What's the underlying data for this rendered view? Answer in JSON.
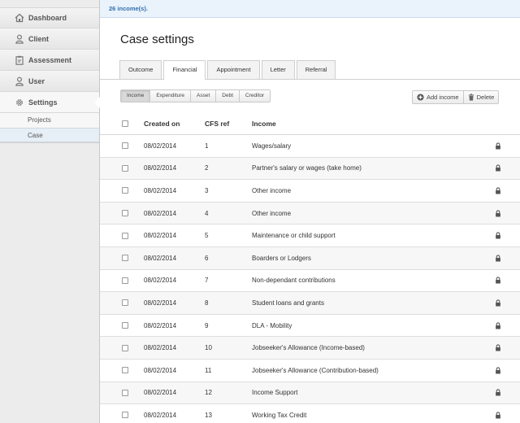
{
  "sidebar": {
    "items": [
      {
        "label": "Dashboard",
        "icon": "home-icon"
      },
      {
        "label": "Client",
        "icon": "user-icon"
      },
      {
        "label": "Assessment",
        "icon": "clipboard-icon"
      },
      {
        "label": "User",
        "icon": "user-icon"
      },
      {
        "label": "Settings",
        "icon": "gear-icon"
      }
    ],
    "subitems": [
      {
        "label": "Projects"
      },
      {
        "label": "Case"
      }
    ]
  },
  "flash": {
    "message": "26 income(s)."
  },
  "page": {
    "title": "Case settings"
  },
  "tabs": [
    {
      "label": "Outcome"
    },
    {
      "label": "Financial"
    },
    {
      "label": "Appointment"
    },
    {
      "label": "Letter"
    },
    {
      "label": "Referral"
    }
  ],
  "segments": [
    {
      "label": "Income"
    },
    {
      "label": "Expenditure"
    },
    {
      "label": "Asset"
    },
    {
      "label": "Debt"
    },
    {
      "label": "Creditor"
    }
  ],
  "actions": {
    "add_label": "Add income",
    "delete_label": "Delete"
  },
  "table": {
    "columns": [
      "Created on",
      "CFS ref",
      "Income"
    ],
    "rows": [
      {
        "date": "08/02/2014",
        "ref": "1",
        "income": "Wages/salary"
      },
      {
        "date": "08/02/2014",
        "ref": "2",
        "income": "Partner's salary or wages (take home)"
      },
      {
        "date": "08/02/2014",
        "ref": "3",
        "income": "Other income"
      },
      {
        "date": "08/02/2014",
        "ref": "4",
        "income": "Other income"
      },
      {
        "date": "08/02/2014",
        "ref": "5",
        "income": "Maintenance or child support"
      },
      {
        "date": "08/02/2014",
        "ref": "6",
        "income": "Boarders or Lodgers"
      },
      {
        "date": "08/02/2014",
        "ref": "7",
        "income": "Non-dependant contributions"
      },
      {
        "date": "08/02/2014",
        "ref": "8",
        "income": "Student loans and grants"
      },
      {
        "date": "08/02/2014",
        "ref": "9",
        "income": "DLA - Mobility"
      },
      {
        "date": "08/02/2014",
        "ref": "10",
        "income": "Jobseeker's Allowance (Income-based)"
      },
      {
        "date": "08/02/2014",
        "ref": "11",
        "income": "Jobseeker's Allowance (Contribution-based)"
      },
      {
        "date": "08/02/2014",
        "ref": "12",
        "income": "Income Support"
      },
      {
        "date": "08/02/2014",
        "ref": "13",
        "income": "Working Tax Credit"
      }
    ]
  },
  "colors": {
    "link": "#2f6fb0",
    "flash_bg": "#eaf2fb"
  }
}
